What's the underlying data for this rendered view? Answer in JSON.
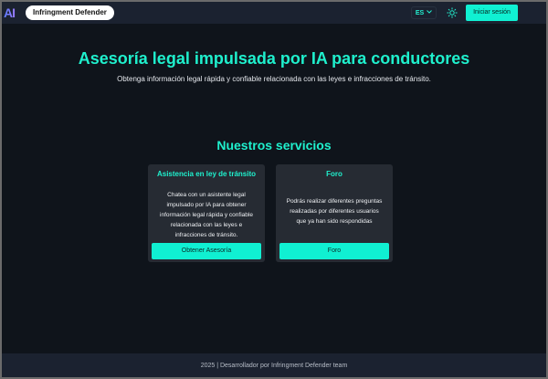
{
  "app": {
    "logo_text": "AI",
    "brand_name": "Infringment Defender"
  },
  "navbar": {
    "language": "ES",
    "login_label": "Iniciar sesión"
  },
  "hero": {
    "title": "Asesoría legal impulsada por IA para conductores",
    "subtitle": "Obtenga información legal rápida y confiable relacionada con las leyes e infracciones de tránsito."
  },
  "services": {
    "title": "Nuestros servicios",
    "cards": [
      {
        "title": "Asistencia en ley de tránsito",
        "description": "Chatea con un asistente legal impulsado por IA para obtener información legal rápida y confiable relacionada con las leyes e infracciones de tránsito.",
        "button_label": "Obtener Asesoría"
      },
      {
        "title": "Foro",
        "description": "Podrás realizar diferentes preguntas realizadas por diferentes usuarios que ya han sido respondidas",
        "button_label": "Foro"
      }
    ]
  },
  "footer": {
    "text": "2025 | Desarrollador por Infringment Defender team"
  },
  "colors": {
    "accent": "#1ff0cd",
    "button": "#10f0d2",
    "background": "#0f141b",
    "navbar": "#1b2230",
    "card": "#262b33"
  },
  "icons": {
    "theme_toggle": "sun-icon",
    "language_dropdown": "chevron-down-icon"
  }
}
